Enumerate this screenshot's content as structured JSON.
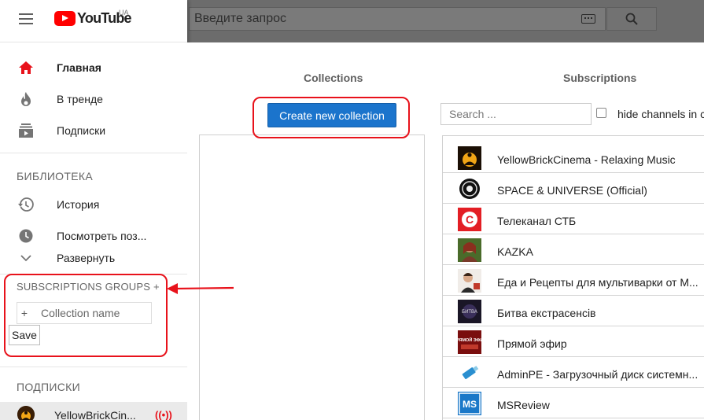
{
  "header": {
    "logo_text": "YouTube",
    "logo_region": "UA",
    "search_placeholder": "Введите запрос"
  },
  "sidebar": {
    "nav": [
      {
        "label": "Главная",
        "icon": "home-icon",
        "active": true
      },
      {
        "label": "В тренде",
        "icon": "fire-icon"
      },
      {
        "label": "Подписки",
        "icon": "subscriptions-icon"
      }
    ],
    "library_title": "БИБЛИОТЕКА",
    "library": [
      {
        "label": "История",
        "icon": "history-icon"
      },
      {
        "label": "Посмотреть поз...",
        "icon": "clock-icon"
      },
      {
        "label": "Развернуть",
        "icon": "chevron-down-icon"
      }
    ],
    "groups_title": "SUBSCRIPTIONS GROUPS +",
    "collection_plus": "+",
    "collection_placeholder": "Collection name",
    "save_label": "Save",
    "subscriptions_title": "ПОДПИСКИ",
    "subscription_item": "YellowBrickCin...",
    "live_icon": "((•))"
  },
  "main": {
    "collections_title": "Collections",
    "create_label": "Create new collection",
    "subscriptions_title": "Subscriptions",
    "search_placeholder": "Search ...",
    "hide_label": "hide channels in c",
    "channels": [
      {
        "name": "YellowBrickCinema - Relaxing Music",
        "icon": "yellowbrick-logo"
      },
      {
        "name": "SPACE & UNIVERSE (Official)",
        "icon": "space-logo"
      },
      {
        "name": "Телеканал СТБ",
        "icon": "stb-logo"
      },
      {
        "name": "KAZKA",
        "icon": "kazka-logo"
      },
      {
        "name": "Еда и Рецепты для мультиварки от М...",
        "icon": "recipes-logo"
      },
      {
        "name": "Битва екстрасенсів",
        "icon": "battle-logo"
      },
      {
        "name": "Прямой эфир",
        "icon": "live-logo"
      },
      {
        "name": "AdminPE - Загрузочный диск системн...",
        "icon": "adminpe-logo"
      },
      {
        "name": "MSReview",
        "icon": "msreview-logo"
      }
    ],
    "stb_letter": "С",
    "battle_text": "БИТВА",
    "live_text": "ПРЯМОЙ ЭФИР",
    "ms_text": "MS"
  },
  "colors": {
    "accent_red": "#e8121b",
    "button_blue": "#1b74cc",
    "youtube_red": "#ff0000"
  }
}
